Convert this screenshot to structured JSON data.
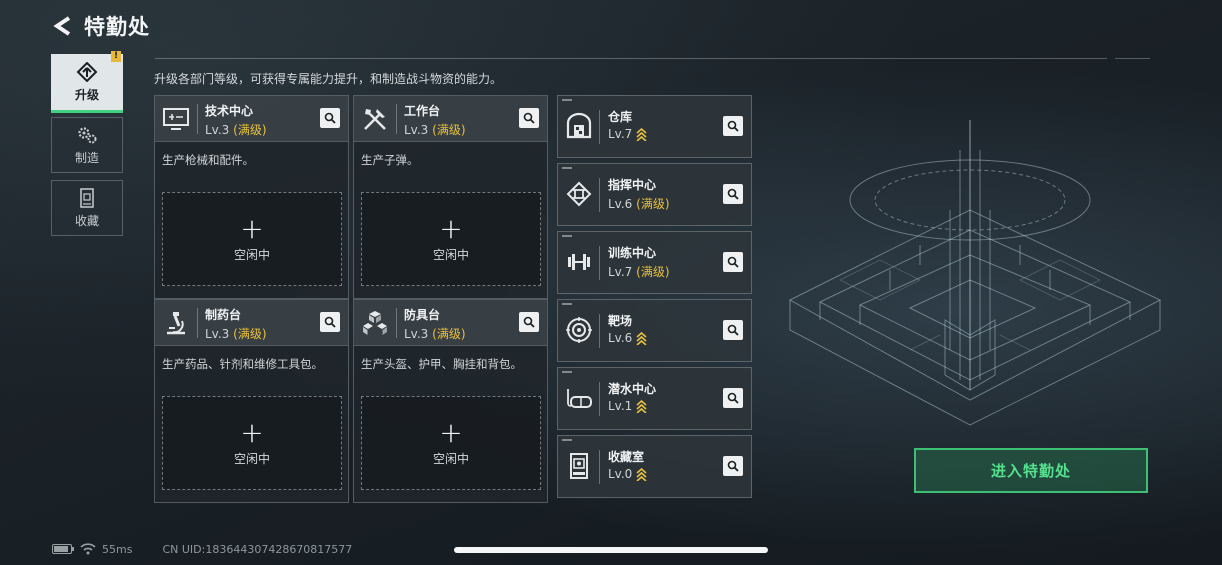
{
  "header": {
    "title": "特勤处"
  },
  "description": "升级各部门等级，可获得专属能力提升，和制造战斗物资的能力。",
  "nav": {
    "items": [
      {
        "label": "升级",
        "icon": "upgrade-icon",
        "active": true,
        "badge": "!"
      },
      {
        "label": "制造",
        "icon": "gears-icon",
        "active": false
      },
      {
        "label": "收藏",
        "icon": "collection-icon",
        "active": false
      }
    ]
  },
  "facilities": [
    {
      "name": "技术中心",
      "level": "Lv.3",
      "status": "(满级)",
      "desc": "生产枪械和配件。",
      "slot_plus": "+",
      "slot_label": "空闲中",
      "icon": "monitor-icon"
    },
    {
      "name": "工作台",
      "level": "Lv.3",
      "status": "(满级)",
      "desc": "生产子弹。",
      "slot_plus": "+",
      "slot_label": "空闲中",
      "icon": "tools-icon"
    },
    {
      "name": "制药台",
      "level": "Lv.3",
      "status": "(满级)",
      "desc": "生产药品、针剂和维修工具包。",
      "slot_plus": "+",
      "slot_label": "空闲中",
      "icon": "microscope-icon"
    },
    {
      "name": "防具台",
      "level": "Lv.3",
      "status": "(满级)",
      "desc": "生产头盔、护甲、胸挂和背包。",
      "slot_plus": "+",
      "slot_label": "空闲中",
      "icon": "boxes-icon"
    }
  ],
  "rooms": [
    {
      "name": "仓库",
      "level": "Lv.7",
      "status": "",
      "upgradable": true,
      "icon": "warehouse-icon"
    },
    {
      "name": "指挥中心",
      "level": "Lv.6",
      "status": "(满级)",
      "upgradable": false,
      "icon": "chip-icon"
    },
    {
      "name": "训练中心",
      "level": "Lv.7",
      "status": "(满级)",
      "upgradable": false,
      "icon": "dumbbell-icon"
    },
    {
      "name": "靶场",
      "level": "Lv.6",
      "status": "",
      "upgradable": true,
      "icon": "target-icon"
    },
    {
      "name": "潜水中心",
      "level": "Lv.1",
      "status": "",
      "upgradable": true,
      "icon": "diving-mask-icon"
    },
    {
      "name": "收藏室",
      "level": "Lv.0",
      "status": "",
      "upgradable": true,
      "icon": "display-case-icon"
    }
  ],
  "enter_button": {
    "label": "进入特勤处"
  },
  "status_bar": {
    "ping": "55ms",
    "uid": "CN UID:183644307428670817577"
  },
  "colors": {
    "accent_green": "#3dbf74",
    "maxed_gold": "#e8c03a"
  }
}
